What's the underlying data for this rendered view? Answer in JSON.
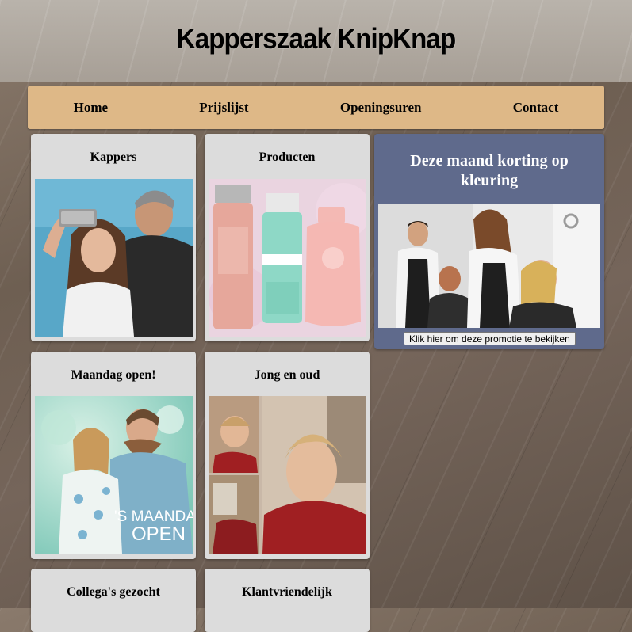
{
  "site": {
    "title": "Kapperszaak KnipKnap"
  },
  "nav": {
    "items": [
      "Home",
      "Prijslijst",
      "Openingsuren",
      "Contact"
    ]
  },
  "cards": [
    {
      "title": "Kappers",
      "image": "hairdresser-selfie-photo"
    },
    {
      "title": "Producten",
      "image": "hair-products-photo"
    },
    {
      "title": "Maandag open!",
      "image": "couple-monday-open-photo",
      "image_text": [
        "'S MAANDAGS",
        "OPEN"
      ]
    },
    {
      "title": "Jong en oud",
      "image": "boy-haircut-collage-photo"
    },
    {
      "title": "Collega's gezocht"
    },
    {
      "title": "Klantvriendelijk"
    }
  ],
  "promo": {
    "title": "Deze maand korting op kleuring",
    "image": "salon-coloring-photo",
    "button_label": "Klik hier om deze promotie te bekijken"
  },
  "colors": {
    "nav_bg": "#deb887",
    "card_bg": "#dcdcdc",
    "promo_bg": "#5f6a8c"
  }
}
